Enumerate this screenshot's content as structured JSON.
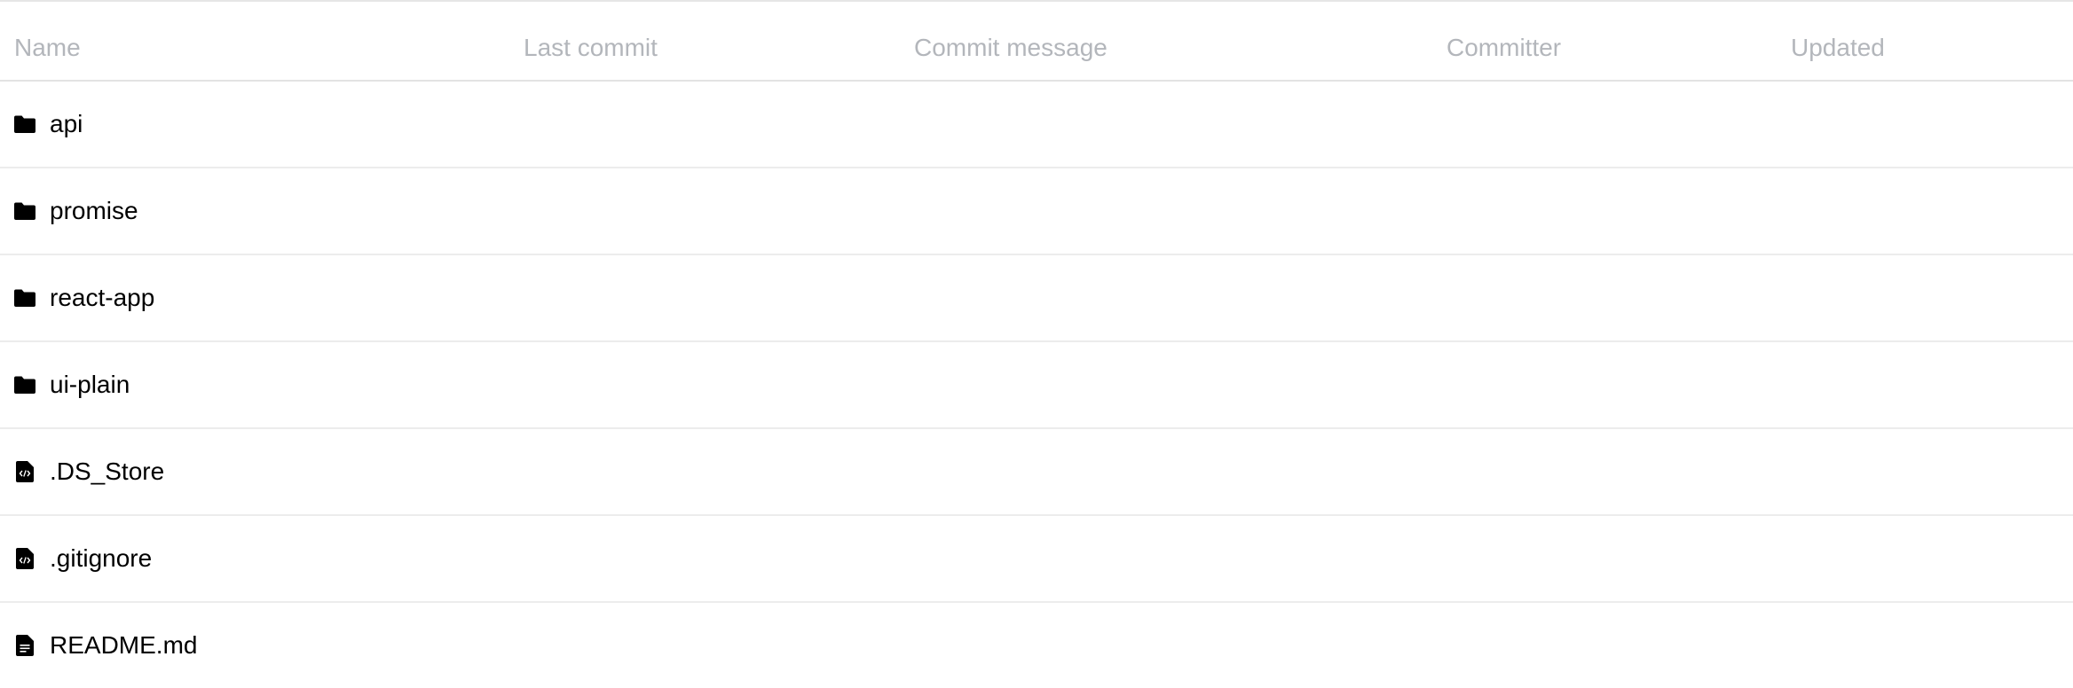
{
  "table": {
    "headers": {
      "name": "Name",
      "last_commit": "Last commit",
      "commit_message": "Commit message",
      "committer": "Committer",
      "updated": "Updated"
    },
    "rows": [
      {
        "name": "api",
        "icon": "folder-icon"
      },
      {
        "name": "promise",
        "icon": "folder-icon"
      },
      {
        "name": "react-app",
        "icon": "folder-icon"
      },
      {
        "name": "ui-plain",
        "icon": "folder-icon"
      },
      {
        "name": ".DS_Store",
        "icon": "code-file-icon"
      },
      {
        "name": ".gitignore",
        "icon": "code-file-icon"
      },
      {
        "name": "README.md",
        "icon": "text-file-icon"
      }
    ]
  }
}
